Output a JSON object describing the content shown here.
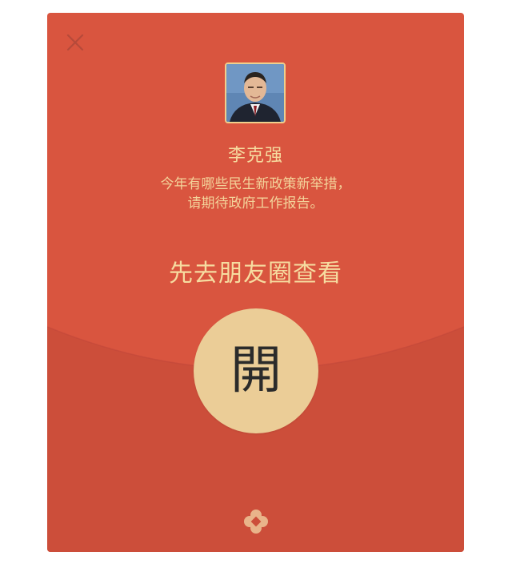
{
  "envelope": {
    "sender_name": "李克强",
    "message_line1": "今年有哪些民生新政策新举措，",
    "message_line2": "请期待政府工作报告。",
    "action_text": "先去朋友圈查看",
    "open_label": "開"
  },
  "icons": {
    "close": "close-icon",
    "avatar": "avatar",
    "logo": "wechat-pay-logo-icon"
  },
  "colors": {
    "envelope_red": "#d9553f",
    "lower_red": "#cc4e3a",
    "gold_text": "#f6dca0",
    "open_button": "#ebcd97"
  }
}
